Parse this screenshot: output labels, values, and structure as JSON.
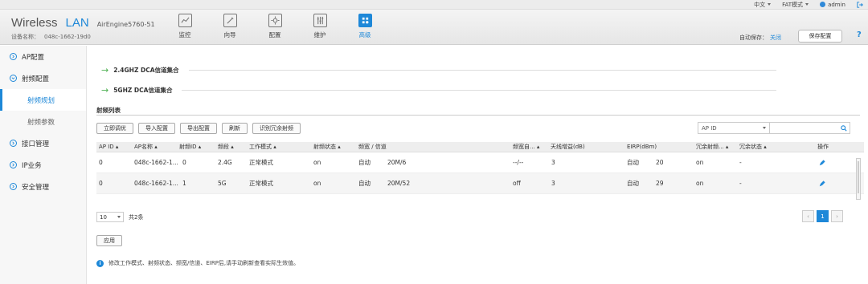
{
  "topbar": {
    "language": "中文",
    "mode": "FAT模式",
    "user": "admin"
  },
  "header": {
    "brand_word1": "Wireless",
    "brand_word2": "LAN",
    "model": "AirEngine5760-51",
    "device_name_label": "设备名称：",
    "device_name_value": "048c-1662-19d0",
    "nav": [
      {
        "label": "监控",
        "icon": "monitor-icon"
      },
      {
        "label": "向导",
        "icon": "wizard-icon"
      },
      {
        "label": "配置",
        "icon": "config-gear-icon"
      },
      {
        "label": "维护",
        "icon": "maintenance-sliders-icon"
      },
      {
        "label": "高级",
        "icon": "advanced-icon"
      }
    ],
    "autosave_label": "自动保存：",
    "autosave_value": "关闭",
    "save_button": "保存配置",
    "help": "?"
  },
  "sidebar": {
    "items": [
      {
        "label": "AP配置"
      },
      {
        "label": "射频配置"
      },
      {
        "label": "射频规划"
      },
      {
        "label": "射频参数"
      },
      {
        "label": "接口管理"
      },
      {
        "label": "IP业务"
      },
      {
        "label": "安全管理"
      }
    ]
  },
  "main": {
    "section1": "2.4GHZ DCA信道集合",
    "section2": "5GHZ DCA信道集合",
    "list_title": "射频列表",
    "buttons": [
      "立即调优",
      "导入配置",
      "导出配置",
      "刷新",
      "识别冗余射频"
    ],
    "search": {
      "field": "AP ID",
      "value": ""
    },
    "table": {
      "headers": [
        "AP ID",
        "AP名称",
        "射频ID",
        "频段",
        "工作模式",
        "射频状态",
        "频宽 / 信道",
        "频宽自...",
        "天线增益(dB)",
        "EIRP(dBm)",
        "冗余射频...",
        "冗余状态",
        "操作"
      ],
      "rows": [
        {
          "ap_id": "0",
          "ap_name": "048c-1662-1...",
          "radio_id": "0",
          "band": "2.4G",
          "mode": "正常模式",
          "status": "on",
          "bw_ch_mode": "自动",
          "bw_ch": "20M/6",
          "auto": "--/--",
          "gain": "3",
          "eirp_mode": "自动",
          "eirp": "20",
          "redundant": "on",
          "red_status": "-"
        },
        {
          "ap_id": "0",
          "ap_name": "048c-1662-1...",
          "radio_id": "1",
          "band": "5G",
          "mode": "正常模式",
          "status": "on",
          "bw_ch_mode": "自动",
          "bw_ch": "20M/52",
          "auto": "off",
          "gain": "3",
          "eirp_mode": "自动",
          "eirp": "29",
          "redundant": "on",
          "red_status": "-"
        }
      ]
    },
    "pager": {
      "page_size": "10",
      "total": "共2条",
      "current_page": "1"
    },
    "apply_button": "应用",
    "note": "修改工作模式、射频状态、频宽/信道、EIRP后,请手动刷新查看实际生效值。"
  }
}
